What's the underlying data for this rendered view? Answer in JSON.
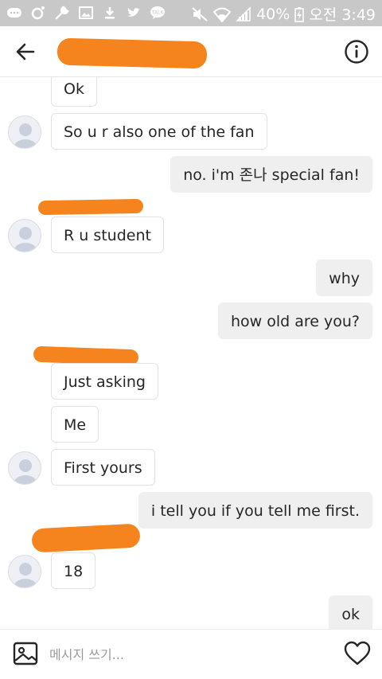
{
  "status_bar": {
    "battery": "40%",
    "time": "오전 3:49",
    "left_icons": [
      "chat-icon",
      "ring-icon",
      "wrench-icon",
      "image-icon",
      "download-icon",
      "twitter-icon",
      "talk-icon"
    ],
    "right_icons": [
      "mute-icon",
      "wifi-icon",
      "signal-icon",
      "battery-icon"
    ]
  },
  "header": {
    "back_icon": "arrow-left-icon",
    "info_icon": "info-icon"
  },
  "messages": [
    {
      "side": "in",
      "text": "Ok",
      "avatar": false
    },
    {
      "side": "in",
      "text": "So u r also one of the fan",
      "avatar": true
    },
    {
      "side": "out",
      "text": "no. i'm 존나 special fan!"
    },
    {
      "side": "in",
      "text": "R u student",
      "avatar": true
    },
    {
      "side": "out",
      "text": "why"
    },
    {
      "side": "out",
      "text": "how old are you?"
    },
    {
      "side": "in",
      "text": "Just asking",
      "avatar": false
    },
    {
      "side": "in",
      "text": "Me",
      "avatar": false
    },
    {
      "side": "in",
      "text": "First yours",
      "avatar": true
    },
    {
      "side": "out",
      "text": "i tell you if you tell me first."
    },
    {
      "side": "in",
      "text": "18",
      "avatar": true
    },
    {
      "side": "out",
      "text": "ok"
    }
  ],
  "composer": {
    "placeholder": "메시지 쓰기...",
    "gallery_icon": "image-icon",
    "like_icon": "heart-icon"
  },
  "colors": {
    "status_bar": "#c8c8c8",
    "redaction": "#f5841f",
    "outgoing_bubble": "#efefef",
    "incoming_border": "#e3e3e3"
  }
}
